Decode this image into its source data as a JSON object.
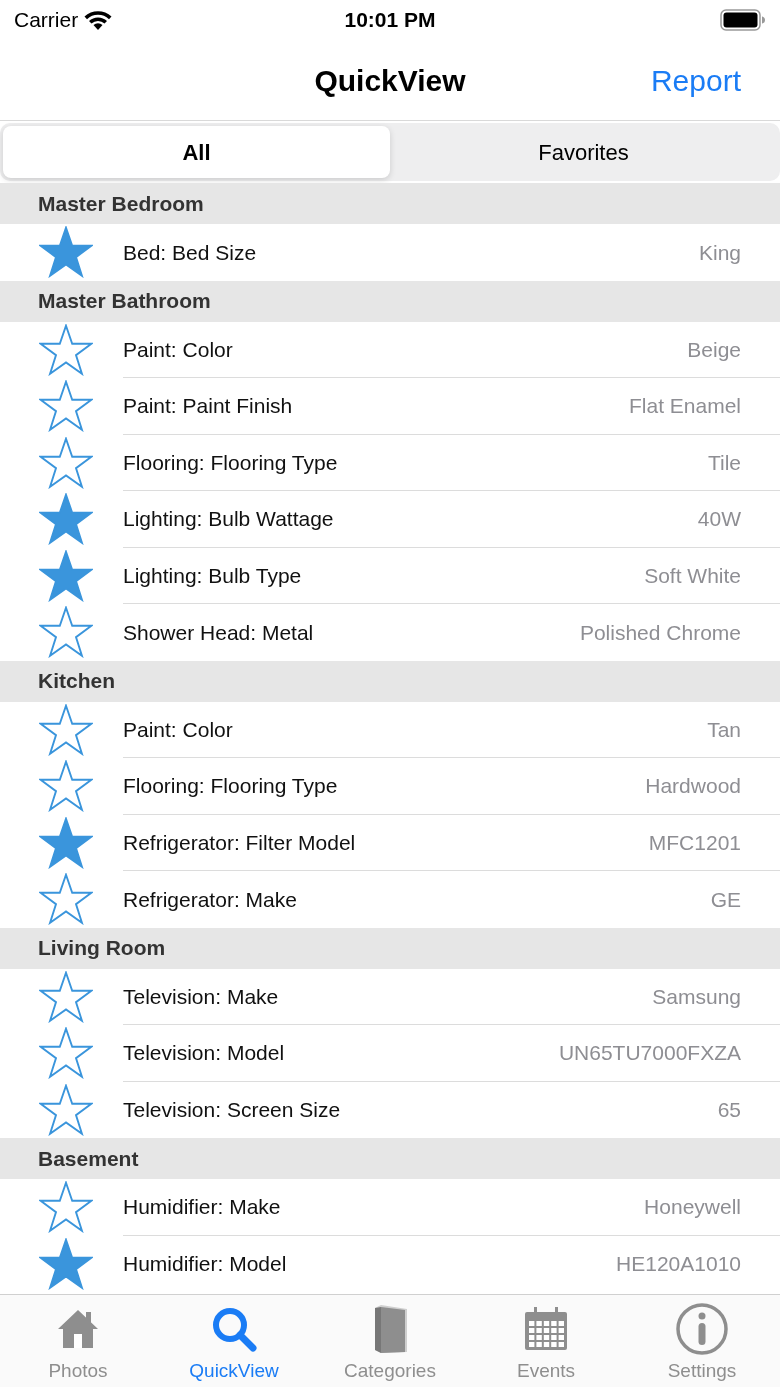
{
  "status_bar": {
    "carrier": "Carrier",
    "time": "10:01 PM"
  },
  "nav_bar": {
    "title": "QuickView",
    "action": "Report"
  },
  "segments": [
    {
      "label": "All",
      "selected": true
    },
    {
      "label": "Favorites",
      "selected": false
    }
  ],
  "sections": [
    {
      "title": "Master Bedroom",
      "rows": [
        {
          "label": "Bed: Bed Size",
          "value": "King",
          "favorite": true
        }
      ]
    },
    {
      "title": "Master Bathroom",
      "rows": [
        {
          "label": "Paint: Color",
          "value": "Beige",
          "favorite": false
        },
        {
          "label": "Paint: Paint Finish",
          "value": "Flat Enamel",
          "favorite": false
        },
        {
          "label": "Flooring: Flooring Type",
          "value": "Tile",
          "favorite": false
        },
        {
          "label": "Lighting: Bulb Wattage",
          "value": "40W",
          "favorite": true
        },
        {
          "label": "Lighting: Bulb Type",
          "value": "Soft White",
          "favorite": true
        },
        {
          "label": "Shower Head: Metal",
          "value": "Polished Chrome",
          "favorite": false
        }
      ]
    },
    {
      "title": "Kitchen",
      "rows": [
        {
          "label": "Paint: Color",
          "value": "Tan",
          "favorite": false
        },
        {
          "label": "Flooring: Flooring Type",
          "value": "Hardwood",
          "favorite": false
        },
        {
          "label": "Refrigerator: Filter Model",
          "value": "MFC1201",
          "favorite": true
        },
        {
          "label": "Refrigerator: Make",
          "value": "GE",
          "favorite": false
        }
      ]
    },
    {
      "title": "Living Room",
      "rows": [
        {
          "label": "Television: Make",
          "value": "Samsung",
          "favorite": false
        },
        {
          "label": "Television: Model",
          "value": "UN65TU7000FXZA",
          "favorite": false
        },
        {
          "label": "Television: Screen Size",
          "value": "65",
          "favorite": false
        }
      ]
    },
    {
      "title": "Basement",
      "rows": [
        {
          "label": "Humidifier: Make",
          "value": "Honeywell",
          "favorite": false
        },
        {
          "label": "Humidifier: Model",
          "value": "HE120A1010",
          "favorite": true
        }
      ]
    }
  ],
  "tab_bar": [
    {
      "label": "Photos",
      "kind": "house",
      "selected": false
    },
    {
      "label": "QuickView",
      "kind": "search",
      "selected": true
    },
    {
      "label": "Categories",
      "kind": "book",
      "selected": false
    },
    {
      "label": "Events",
      "kind": "calendar",
      "selected": false
    },
    {
      "label": "Settings",
      "kind": "info",
      "selected": false
    }
  ]
}
